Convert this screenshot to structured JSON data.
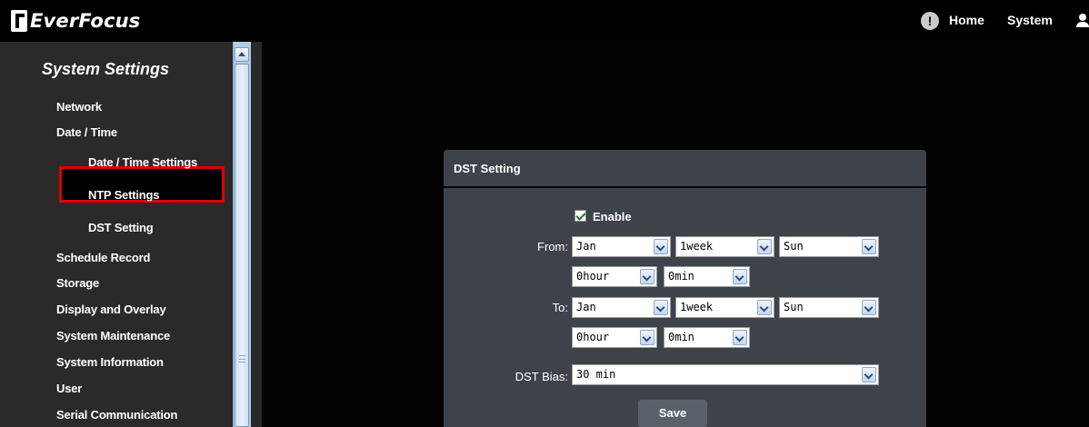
{
  "header": {
    "brand": "EverFocus",
    "nav_home": "Home",
    "nav_system": "System"
  },
  "sidebar": {
    "title": "System Settings",
    "items": [
      {
        "label": "Network"
      },
      {
        "label": "Date / Time"
      },
      {
        "label": "Date / Time Settings"
      },
      {
        "label": "NTP Settings"
      },
      {
        "label": "DST Setting"
      },
      {
        "label": "Schedule Record"
      },
      {
        "label": "Storage"
      },
      {
        "label": "Display and Overlay"
      },
      {
        "label": "System Maintenance"
      },
      {
        "label": "System Information"
      },
      {
        "label": "User"
      },
      {
        "label": "Serial Communication"
      }
    ]
  },
  "dialog": {
    "title": "DST Setting",
    "enable_label": "Enable",
    "from_label": "From:",
    "to_label": "To:",
    "bias_label": "DST Bias:",
    "from": {
      "month": "Jan",
      "week": "1week",
      "day": "Sun",
      "hour": "0hour",
      "min": "0min"
    },
    "to": {
      "month": "Jan",
      "week": "1week",
      "day": "Sun",
      "hour": "0hour",
      "min": "0min"
    },
    "bias": "30 min",
    "save_label": "Save"
  },
  "colors": {
    "highlight": "#e00000",
    "dialog_bg": "#3e4349",
    "sidebar_bg": "#2a2a2a"
  }
}
